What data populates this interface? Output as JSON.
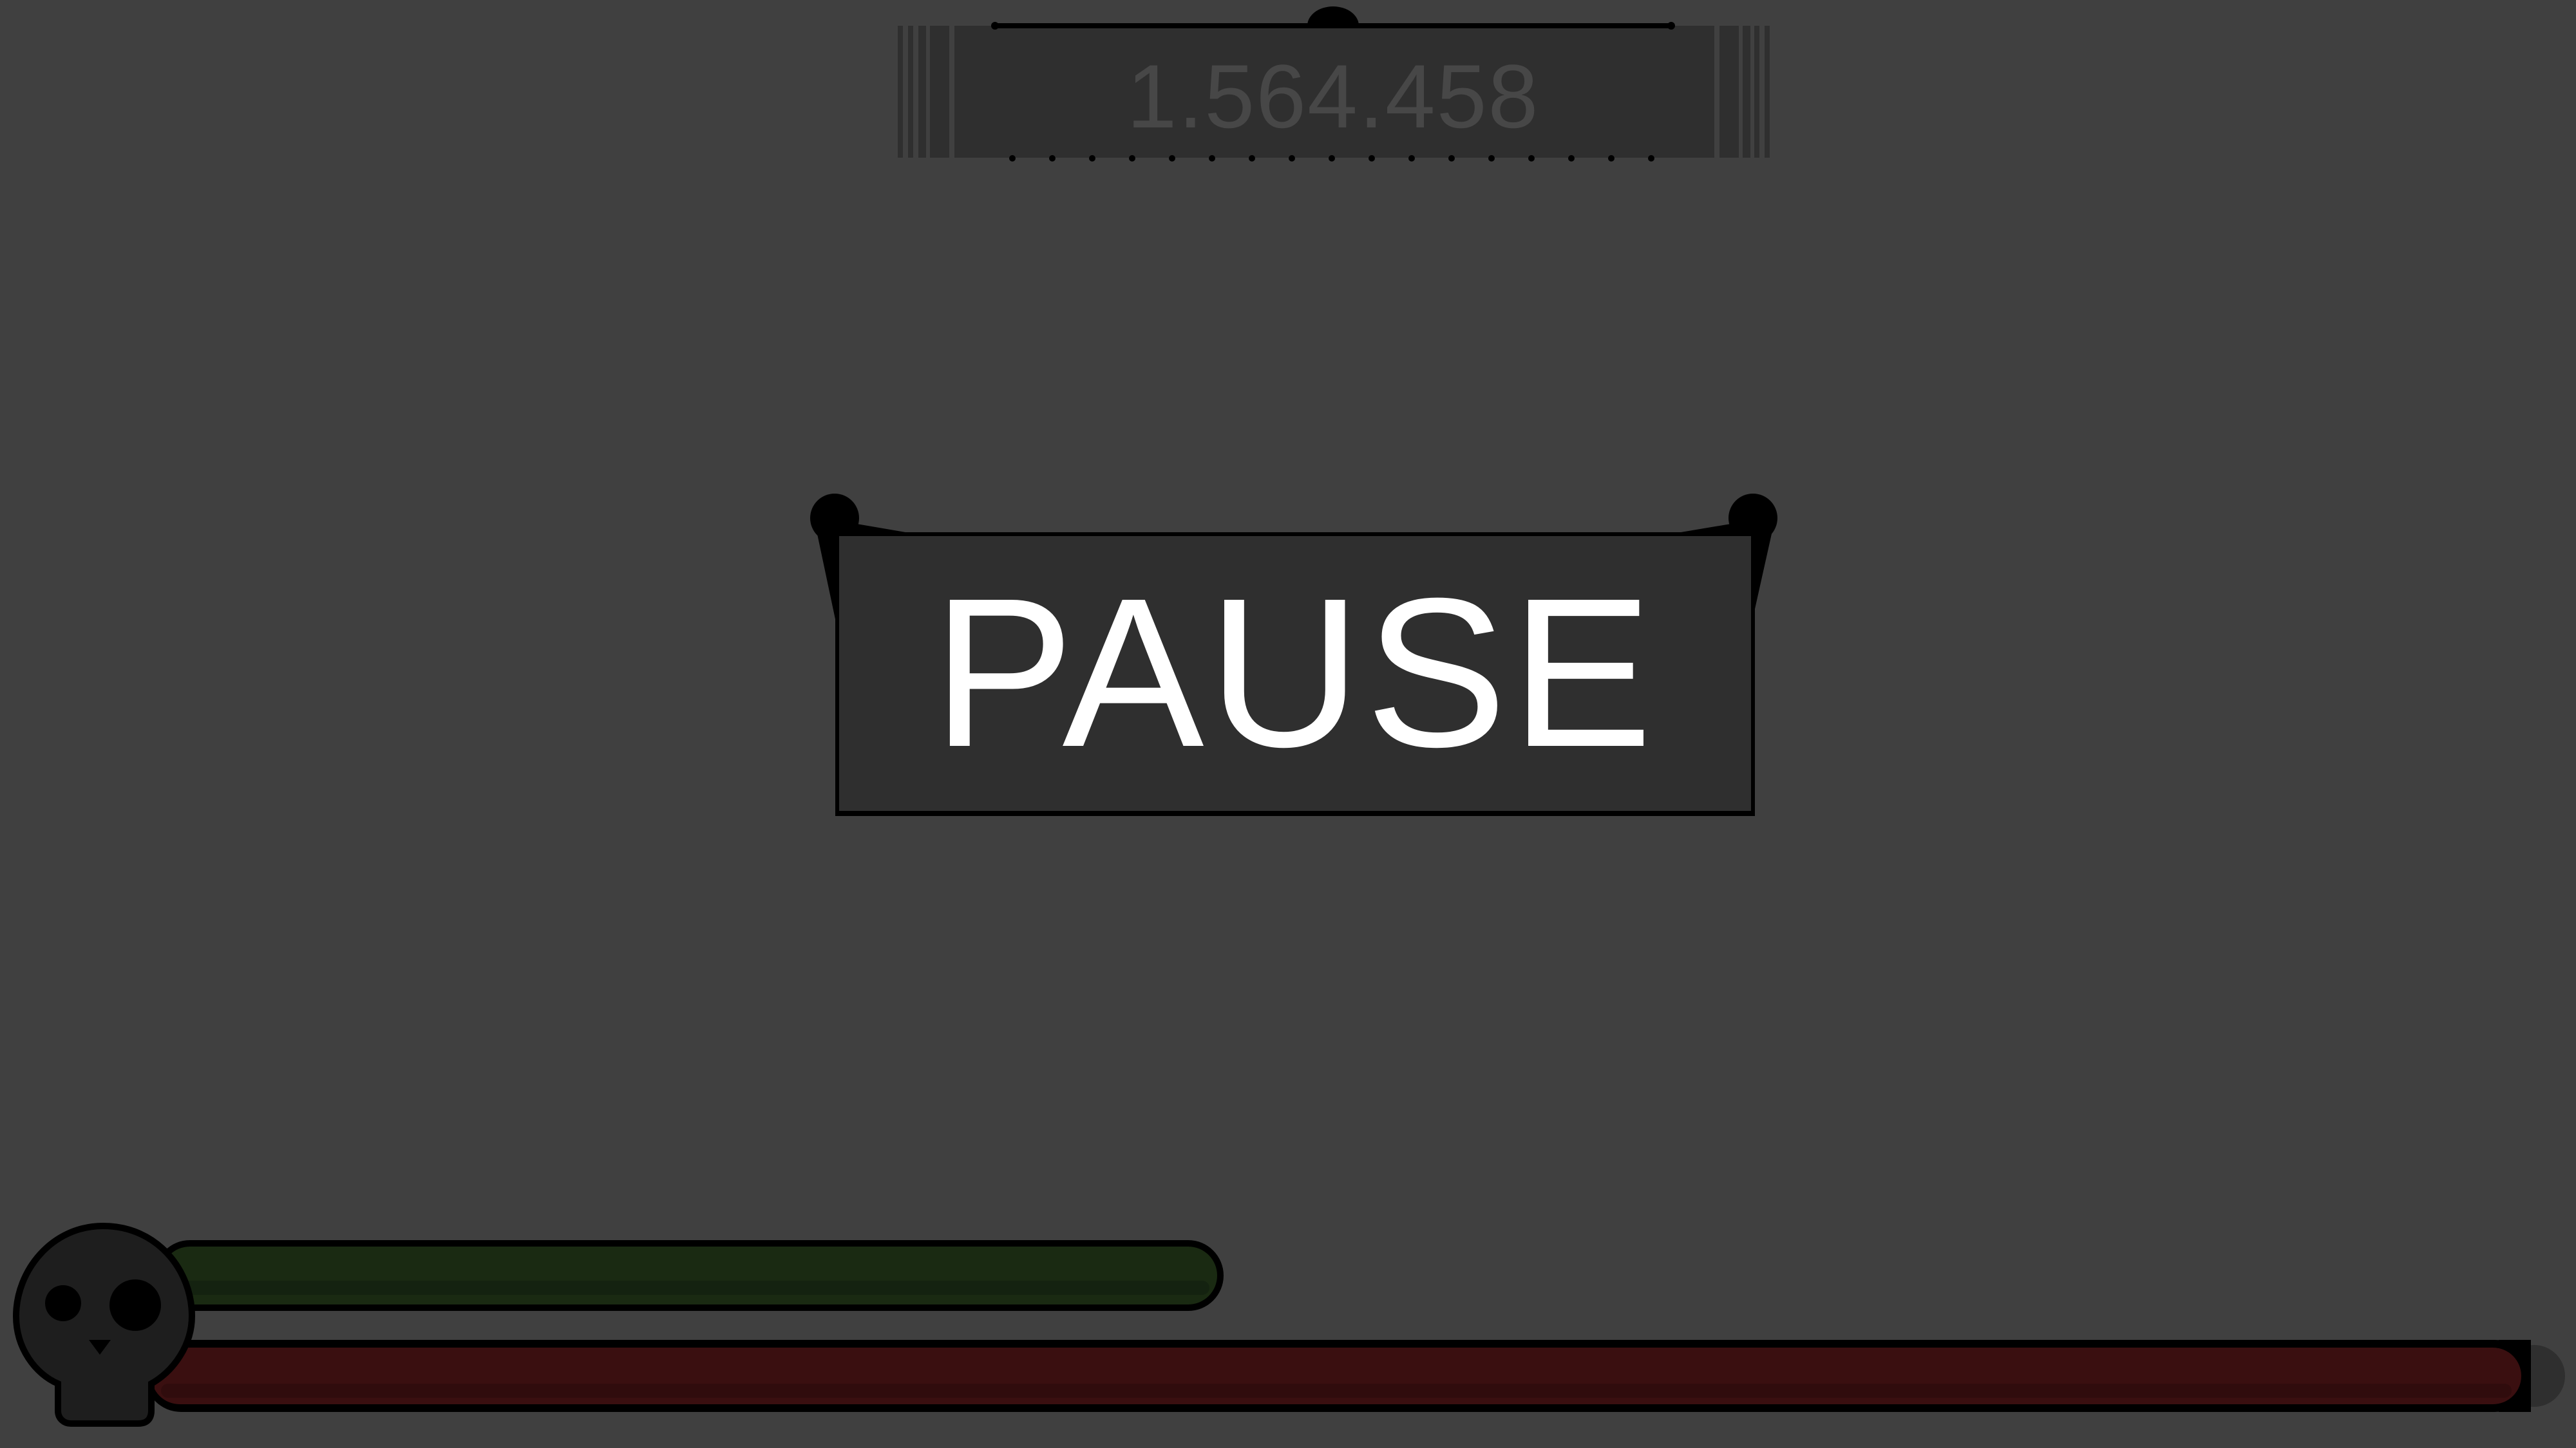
{
  "hud": {
    "score": "1.564.458",
    "stamina_fraction": 0.41,
    "health_fraction": 0.99
  },
  "pause_menu": {
    "title": "PAUSE"
  },
  "colors": {
    "background": "#404040",
    "panel": "#2f2f2f",
    "outline": "#000000",
    "score_text": "#474747",
    "title_text": "#ffffff",
    "stamina_bar": "#1a2a12",
    "health_bar": "#3a0f10",
    "skull": "#1e1e1e"
  },
  "icons": {
    "player_status": "skull-icon"
  }
}
